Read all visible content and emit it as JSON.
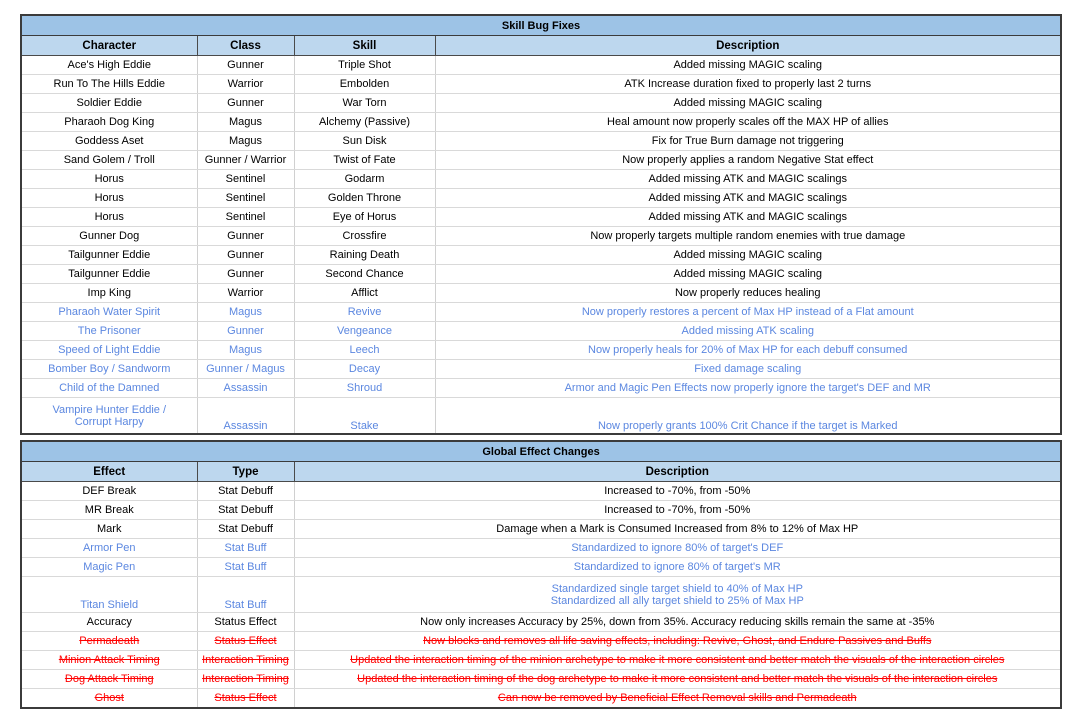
{
  "tables": [
    {
      "id": "skill-bug-fixes",
      "title": "Skill Bug Fixes",
      "columns": [
        "Character",
        "Class",
        "Skill",
        "Description"
      ],
      "rows": [
        {
          "style": "normal",
          "cells": [
            "Ace's High Eddie",
            "Gunner",
            "Triple Shot",
            "Added missing MAGIC scaling"
          ]
        },
        {
          "style": "normal",
          "cells": [
            "Run To The Hills Eddie",
            "Warrior",
            "Embolden",
            "ATK Increase duration fixed to properly last 2 turns"
          ]
        },
        {
          "style": "normal",
          "cells": [
            "Soldier Eddie",
            "Gunner",
            "War Torn",
            "Added missing MAGIC scaling"
          ]
        },
        {
          "style": "normal",
          "cells": [
            "Pharaoh Dog King",
            "Magus",
            "Alchemy (Passive)",
            "Heal amount now properly scales off the MAX HP of allies"
          ]
        },
        {
          "style": "normal",
          "cells": [
            "Goddess Aset",
            "Magus",
            "Sun Disk",
            "Fix for True Burn damage not triggering"
          ]
        },
        {
          "style": "normal",
          "cells": [
            "Sand Golem / Troll",
            "Gunner / Warrior",
            "Twist of Fate",
            "Now properly applies a random Negative Stat effect"
          ]
        },
        {
          "style": "normal",
          "cells": [
            "Horus",
            "Sentinel",
            "Godarm",
            "Added missing ATK and MAGIC scalings"
          ]
        },
        {
          "style": "normal",
          "cells": [
            "Horus",
            "Sentinel",
            "Golden Throne",
            "Added missing ATK and MAGIC scalings"
          ]
        },
        {
          "style": "normal",
          "cells": [
            "Horus",
            "Sentinel",
            "Eye of Horus",
            "Added missing ATK and MAGIC scalings"
          ]
        },
        {
          "style": "normal",
          "cells": [
            "Gunner Dog",
            "Gunner",
            "Crossfire",
            "Now properly targets multiple random enemies with true damage"
          ]
        },
        {
          "style": "normal",
          "cells": [
            "Tailgunner Eddie",
            "Gunner",
            "Raining Death",
            "Added missing MAGIC scaling"
          ]
        },
        {
          "style": "normal",
          "cells": [
            "Tailgunner Eddie",
            "Gunner",
            "Second Chance",
            "Added missing MAGIC scaling"
          ]
        },
        {
          "style": "normal",
          "cells": [
            "Imp King",
            "Warrior",
            "Afflict",
            "Now properly reduces healing"
          ]
        },
        {
          "style": "blue",
          "cells": [
            "Pharaoh Water Spirit",
            "Magus",
            "Revive",
            "Now properly restores a percent of Max HP instead of a Flat amount"
          ]
        },
        {
          "style": "blue",
          "cells": [
            "The Prisoner",
            "Gunner",
            "Vengeance",
            "Added missing ATK scaling"
          ]
        },
        {
          "style": "blue",
          "cells": [
            "Speed of Light Eddie",
            "Magus",
            "Leech",
            "Now properly heals for 20% of Max HP for each debuff consumed"
          ]
        },
        {
          "style": "blue",
          "cells": [
            "Bomber Boy / Sandworm",
            "Gunner / Magus",
            "Decay",
            "Fixed damage scaling"
          ]
        },
        {
          "style": "blue",
          "cells": [
            "Child of the Damned",
            "Assassin",
            "Shroud",
            "Armor and Magic Pen Effects now properly ignore the target's DEF and MR"
          ]
        },
        {
          "style": "blue",
          "tall": true,
          "bottom_align": [
            1,
            2,
            3
          ],
          "cells": [
            "Vampire Hunter Eddie /\nCorrupt Harpy",
            "Assassin",
            "Stake",
            "Now properly grants 100% Crit Chance if the target is Marked"
          ]
        }
      ]
    },
    {
      "id": "global-effect-changes",
      "title": "Global Effect Changes",
      "columns": [
        "Effect",
        "Type",
        "Description"
      ],
      "rows": [
        {
          "style": "normal",
          "cells": [
            "DEF Break",
            "Stat Debuff",
            "Increased to -70%, from -50%"
          ]
        },
        {
          "style": "normal",
          "cells": [
            "MR Break",
            "Stat Debuff",
            "Increased to -70%, from -50%"
          ]
        },
        {
          "style": "normal",
          "cells": [
            "Mark",
            "Stat Debuff",
            "Damage when a Mark is Consumed Increased from 8% to 12% of Max HP"
          ]
        },
        {
          "style": "blue",
          "cells": [
            "Armor Pen",
            "Stat Buff",
            "Standardized to ignore 80% of target's DEF"
          ]
        },
        {
          "style": "blue",
          "cells": [
            "Magic Pen",
            "Stat Buff",
            "Standardized to ignore 80% of target's MR"
          ]
        },
        {
          "style": "blue",
          "tall": true,
          "bottom_align": [
            0,
            1
          ],
          "cells": [
            "Titan Shield",
            "Stat Buff",
            "Standardized single target shield to 40% of Max HP\nStandardized all ally target shield to 25% of Max HP"
          ]
        },
        {
          "style": "normal",
          "cells": [
            "Accuracy",
            "Status Effect",
            "Now only increases Accuracy by 25%, down from 35%. Accuracy reducing skills remain the same at -35%"
          ]
        },
        {
          "style": "strike",
          "cells": [
            "Permadeath",
            "Status Effect",
            "Now blocks and removes all life saving effects, including: Revive, Ghost, and Endure Passives and Buffs"
          ]
        },
        {
          "style": "strike",
          "cells": [
            "Minion Attack Timing",
            "Interaction Timing",
            "Updated the interaction timing of the minion archetype to make it more consistent and better match the visuals of the interaction circles"
          ]
        },
        {
          "style": "strike",
          "cells": [
            "Dog Attack Timing",
            "Interaction Timing",
            "Updated the interaction timing of the dog archetype to make it more consistent and better match the visuals of the interaction circles"
          ]
        },
        {
          "style": "strike",
          "cells": [
            "Ghost",
            "Status Effect",
            "Can now be removed by Beneficial Effect Removal skills and Permadeath"
          ]
        }
      ]
    }
  ],
  "colors": {
    "title_bar": "#9DC3E6",
    "header_row": "#BDD7EE",
    "border": "#3B3B3B",
    "text_normal": "#000000",
    "text_blue": "#5B87E0",
    "text_strike": "#FF0000"
  }
}
